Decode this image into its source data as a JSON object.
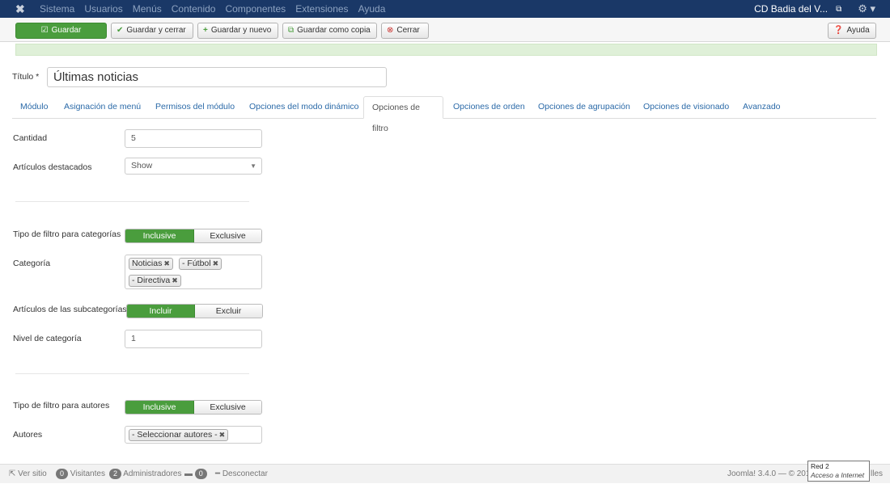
{
  "topbar": {
    "menu": [
      "Sistema",
      "Usuarios",
      "Menús",
      "Contenido",
      "Componentes",
      "Extensiones",
      "Ayuda"
    ],
    "site_name": "CD Badia del V...",
    "logo_icon": "joomla-logo",
    "external_icon": "external-link-icon",
    "gear_icon": "gear-icon"
  },
  "toolbar": {
    "save": "Guardar",
    "save_close": "Guardar y cerrar",
    "save_new": "Guardar y nuevo",
    "save_copy": "Guardar como copia",
    "close": "Cerrar",
    "help": "Ayuda"
  },
  "form": {
    "title_label": "Título *",
    "title_value": "Últimas noticias"
  },
  "tabs": [
    "Módulo",
    "Asignación de menú",
    "Permisos del módulo",
    "Opciones del modo dinámico",
    "Opciones de filtro",
    "Opciones de orden",
    "Opciones de agrupación",
    "Opciones de visionado",
    "Avanzado"
  ],
  "active_tab": "Opciones de filtro",
  "fields": {
    "cantidad_label": "Cantidad",
    "cantidad_value": "5",
    "destacados_label": "Artículos destacados",
    "destacados_value": "Show",
    "tipo_cat_label": "Tipo de filtro para categorías",
    "tipo_cat_on": "Inclusive",
    "tipo_cat_off": "Exclusive",
    "categoria_label": "Categoría",
    "categoria_chips": [
      "Noticias",
      "- Fútbol",
      "- Directiva"
    ],
    "subcat_label": "Artículos de las subcategorías",
    "subcat_on": "Incluir",
    "subcat_off": "Excluir",
    "nivel_label": "Nivel de categoría",
    "nivel_value": "1",
    "tipo_aut_label": "Tipo de filtro para autores",
    "tipo_aut_on": "Inclusive",
    "tipo_aut_off": "Exclusive",
    "autores_label": "Autores",
    "autores_chip": "- Seleccionar autores -"
  },
  "statusbar": {
    "view_site": "Ver sitio",
    "visitors_count": "0",
    "visitors": "Visitantes",
    "admins_count": "2",
    "admins": "Administradores",
    "messages_count": "0",
    "logout": "Desconectar",
    "version": "Joomla! 3.4.0 — © 201",
    "trailing": "lles"
  },
  "tooltip": {
    "line1": "Red 2",
    "line2": "Acceso a Internet"
  },
  "colors": {
    "topbar": "#1a3867",
    "green": "#4a9d3d",
    "link": "#2b6aa8"
  }
}
